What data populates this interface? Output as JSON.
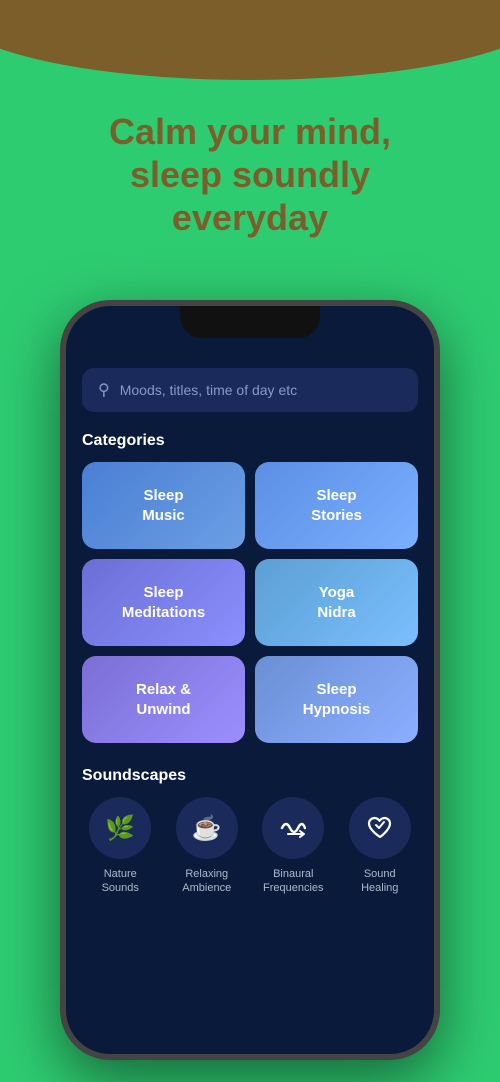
{
  "background": {
    "top_arc_color": "#7B5E2A",
    "bg_color": "#2ECC71"
  },
  "headline": {
    "line1": "Calm your mind,",
    "line2": "sleep soundly",
    "line3": "everyday",
    "full": "Calm your mind,\nsleep soundly\neveryday"
  },
  "search": {
    "placeholder": "Moods, titles, time of day etc",
    "icon": "🔍"
  },
  "sections": {
    "categories_title": "Categories",
    "soundscapes_title": "Soundscapes"
  },
  "categories": [
    {
      "id": "sleep-music",
      "label": "Sleep\nMusic",
      "line1": "Sleep",
      "line2": "Music",
      "gradient": "card-sleep-music"
    },
    {
      "id": "sleep-stories",
      "label": "Sleep\nStories",
      "line1": "Sleep",
      "line2": "Stories",
      "gradient": "card-sleep-stories"
    },
    {
      "id": "sleep-meditations",
      "label": "Sleep\nMeditations",
      "line1": "Sleep",
      "line2": "Meditations",
      "gradient": "card-sleep-meditations"
    },
    {
      "id": "yoga-nidra",
      "label": "Yoga\nNidra",
      "line1": "Yoga",
      "line2": "Nidra",
      "gradient": "card-yoga-nidra"
    },
    {
      "id": "relax-unwind",
      "label": "Relax &\nUnwind",
      "line1": "Relax &",
      "line2": "Unwind",
      "gradient": "card-relax-unwind"
    },
    {
      "id": "sleep-hypnosis",
      "label": "Sleep\nHypnosis",
      "line1": "Sleep",
      "line2": "Hypnosis",
      "gradient": "card-sleep-hypnosis"
    }
  ],
  "soundscapes": [
    {
      "id": "nature-sounds",
      "icon": "🌿",
      "label": "Nature\nSounds"
    },
    {
      "id": "relaxing-ambience",
      "icon": "☕",
      "label": "Relaxing\nAmbience"
    },
    {
      "id": "binaural-frequencies",
      "icon": "♫",
      "label": "Binaural\nFrequencies"
    },
    {
      "id": "sound-healing",
      "icon": "❤",
      "label": "Sound\nHealing"
    }
  ]
}
